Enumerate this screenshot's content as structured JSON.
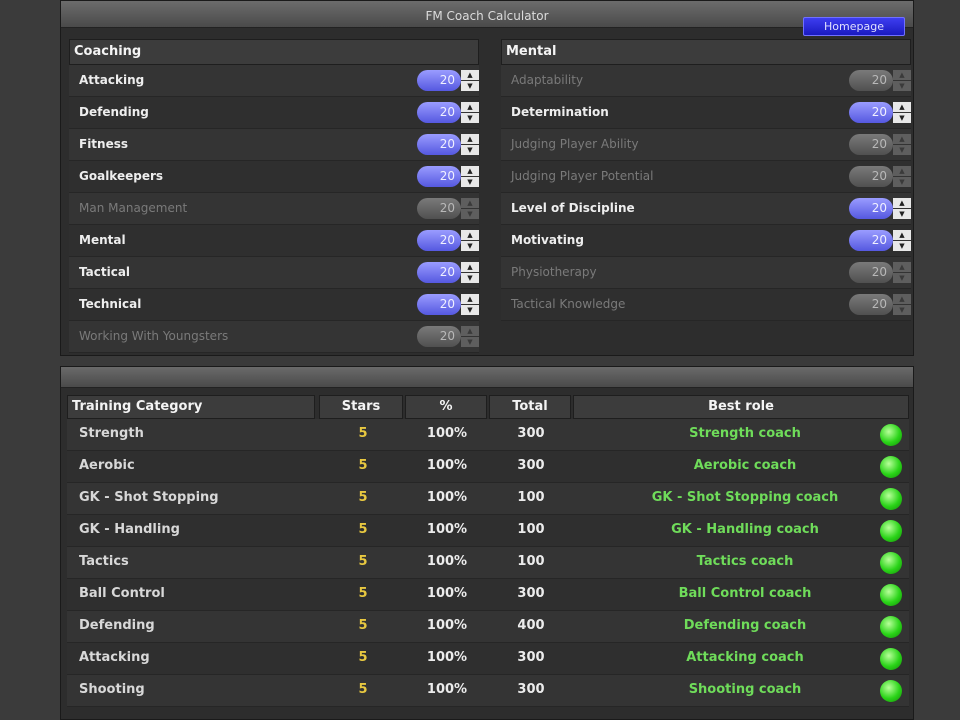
{
  "title": "FM Coach Calculator",
  "homepage_label": "Homepage",
  "coaching": {
    "header": "Coaching",
    "items": [
      {
        "label": "Attacking",
        "value": "20",
        "on": true
      },
      {
        "label": "Defending",
        "value": "20",
        "on": true
      },
      {
        "label": "Fitness",
        "value": "20",
        "on": true
      },
      {
        "label": "Goalkeepers",
        "value": "20",
        "on": true
      },
      {
        "label": "Man Management",
        "value": "20",
        "on": false
      },
      {
        "label": "Mental",
        "value": "20",
        "on": true
      },
      {
        "label": "Tactical",
        "value": "20",
        "on": true
      },
      {
        "label": "Technical",
        "value": "20",
        "on": true
      },
      {
        "label": "Working With Youngsters",
        "value": "20",
        "on": false
      }
    ]
  },
  "mental": {
    "header": "Mental",
    "items": [
      {
        "label": "Adaptability",
        "value": "20",
        "on": false
      },
      {
        "label": "Determination",
        "value": "20",
        "on": true
      },
      {
        "label": "Judging Player Ability",
        "value": "20",
        "on": false
      },
      {
        "label": "Judging Player Potential",
        "value": "20",
        "on": false
      },
      {
        "label": "Level of Discipline",
        "value": "20",
        "on": true
      },
      {
        "label": "Motivating",
        "value": "20",
        "on": true
      },
      {
        "label": "Physiotherapy",
        "value": "20",
        "on": false
      },
      {
        "label": "Tactical Knowledge",
        "value": "20",
        "on": false
      }
    ]
  },
  "table": {
    "headers": [
      "Training Category",
      "Stars",
      "%",
      "Total",
      "Best role"
    ],
    "rows": [
      {
        "category": "Strength",
        "stars": "5",
        "pct": "100%",
        "total": "300",
        "role": "Strength coach"
      },
      {
        "category": "Aerobic",
        "stars": "5",
        "pct": "100%",
        "total": "300",
        "role": "Aerobic coach"
      },
      {
        "category": "GK - Shot Stopping",
        "stars": "5",
        "pct": "100%",
        "total": "100",
        "role": "GK - Shot Stopping coach"
      },
      {
        "category": "GK - Handling",
        "stars": "5",
        "pct": "100%",
        "total": "100",
        "role": "GK - Handling coach"
      },
      {
        "category": "Tactics",
        "stars": "5",
        "pct": "100%",
        "total": "100",
        "role": "Tactics coach"
      },
      {
        "category": "Ball Control",
        "stars": "5",
        "pct": "100%",
        "total": "300",
        "role": "Ball Control coach"
      },
      {
        "category": "Defending",
        "stars": "5",
        "pct": "100%",
        "total": "400",
        "role": "Defending coach"
      },
      {
        "category": "Attacking",
        "stars": "5",
        "pct": "100%",
        "total": "300",
        "role": "Attacking coach"
      },
      {
        "category": "Shooting",
        "stars": "5",
        "pct": "100%",
        "total": "300",
        "role": "Shooting coach"
      }
    ]
  },
  "icons": {
    "spin_up": "triangle-up-icon",
    "spin_down": "triangle-down-icon",
    "status": "green-status-dot-icon"
  },
  "colors": {
    "accent_on": "#6f72f0",
    "role_text": "#6fdc5a",
    "stars_text": "#e8c840",
    "status_dot": "#2ad418"
  }
}
